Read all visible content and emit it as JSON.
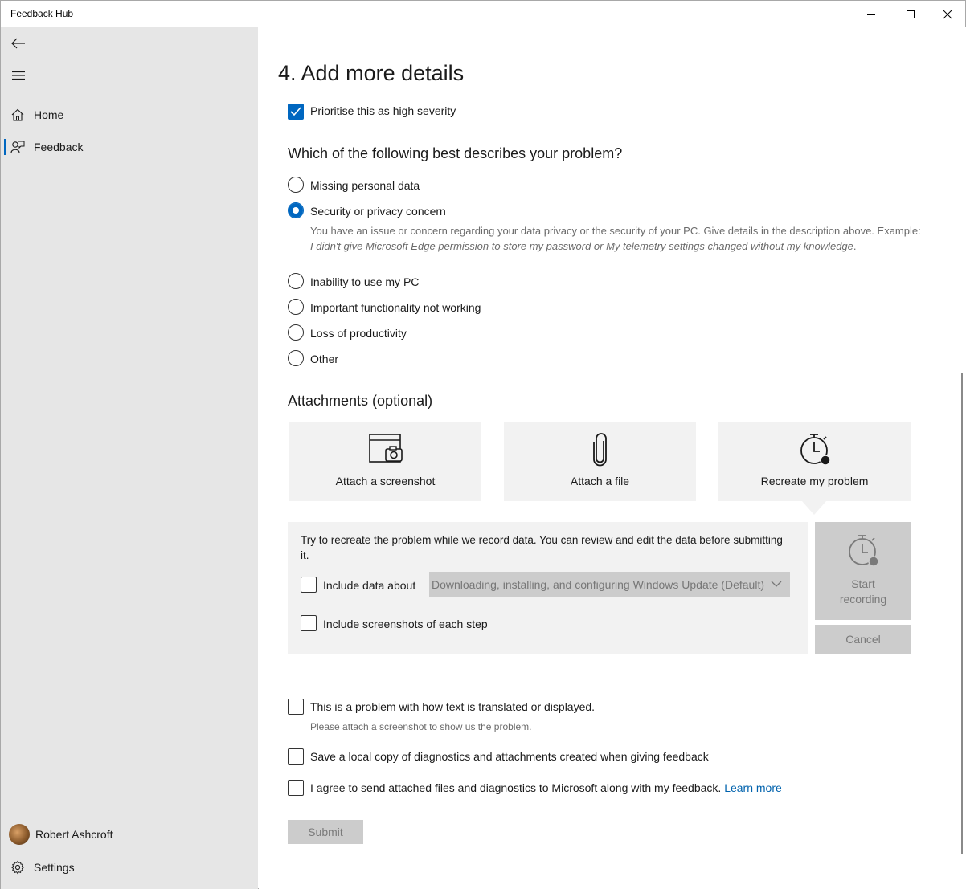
{
  "window": {
    "title": "Feedback Hub"
  },
  "sidebar": {
    "nav": [
      {
        "label": "Home",
        "icon": "home-icon"
      },
      {
        "label": "Feedback",
        "icon": "feedback-icon",
        "active": true
      }
    ],
    "user_name": "Robert Ashcroft",
    "settings_label": "Settings"
  },
  "main": {
    "heading": "4. Add more details",
    "high_severity": {
      "label": "Prioritise this as high severity",
      "checked": true
    },
    "problem_question": "Which of the following best describes your problem?",
    "problem_options": [
      {
        "label": "Missing personal data",
        "selected": false
      },
      {
        "label": "Security or privacy concern",
        "selected": true
      },
      {
        "label": "Inability to use my PC",
        "selected": false
      },
      {
        "label": "Important functionality not working",
        "selected": false
      },
      {
        "label": "Loss of productivity",
        "selected": false
      },
      {
        "label": "Other",
        "selected": false
      }
    ],
    "selected_description": {
      "text": "You have an issue or concern regarding your data privacy or the security of your PC. Give details in the description above.",
      "example_prefix": "Example: ",
      "example_text": "I didn't give Microsoft Edge permission to store my password or My telemetry settings changed without my knowledge",
      "example_suffix": "."
    },
    "attachments": {
      "heading": "Attachments (optional)",
      "tiles": [
        {
          "label": "Attach a screenshot",
          "icon": "screenshot-icon"
        },
        {
          "label": "Attach a file",
          "icon": "paperclip-icon"
        },
        {
          "label": "Recreate my problem",
          "icon": "stopwatch-record-icon"
        }
      ]
    },
    "recreate_panel": {
      "instructions": "Try to recreate the problem while we record data. You can review and edit the data before submitting it.",
      "include_data_label": "Include data about",
      "include_data_checked": false,
      "dropdown_value": "Downloading, installing, and configuring Windows Update (Default)",
      "include_screenshots_label": "Include screenshots of each step",
      "include_screenshots_checked": false,
      "start_recording_line1": "Start",
      "start_recording_line2": "recording",
      "cancel_label": "Cancel"
    },
    "translation": {
      "label": "This is a problem with how text is translated or displayed.",
      "hint": "Please attach a screenshot to show us the problem.",
      "checked": false
    },
    "local_copy": {
      "label": "Save a local copy of diagnostics and attachments created when giving feedback",
      "checked": false
    },
    "agree": {
      "label": "I agree to send attached files and diagnostics to Microsoft along with my feedback.",
      "link": "Learn more",
      "checked": false
    },
    "submit_label": "Submit"
  },
  "colors": {
    "accent": "#0067c0",
    "sidebar_bg": "#e6e6e6",
    "tile_bg": "#f2f2f2",
    "disabled_bg": "#cccccc",
    "link": "#0062ad"
  }
}
